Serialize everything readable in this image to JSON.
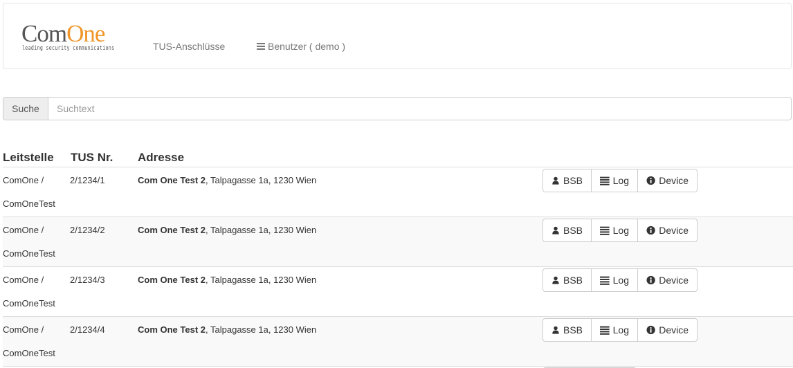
{
  "brand": {
    "logo_com": "Com",
    "logo_one": "One",
    "tagline": "leading security communications"
  },
  "nav": {
    "tus_link": "TUS-Anschlüsse",
    "user_menu": "Benutzer ( demo )",
    "user_menu_icon": "hamburger-icon"
  },
  "search": {
    "label": "Suche",
    "placeholder": "Suchtext",
    "value": ""
  },
  "table": {
    "headers": [
      "Leitstelle",
      "TUS Nr.",
      "Adresse"
    ],
    "rows": [
      {
        "leitstelle_line1": "ComOne /",
        "leitstelle_line2": "ComOneTest",
        "tus_nr": "2/1234/1",
        "address_name": "Com One Test 2",
        "address_rest": ", Talpagasse 1a, 1230 Wien"
      },
      {
        "leitstelle_line1": "ComOne /",
        "leitstelle_line2": "ComOneTest",
        "tus_nr": "2/1234/2",
        "address_name": "Com One Test 2",
        "address_rest": ", Talpagasse 1a, 1230 Wien"
      },
      {
        "leitstelle_line1": "ComOne /",
        "leitstelle_line2": "ComOneTest",
        "tus_nr": "2/1234/3",
        "address_name": "Com One Test 2",
        "address_rest": ", Talpagasse 1a, 1230 Wien"
      },
      {
        "leitstelle_line1": "ComOne /",
        "leitstelle_line2": "ComOneTest",
        "tus_nr": "2/1234/4",
        "address_name": "Com One Test 2",
        "address_rest": ", Talpagasse 1a, 1230 Wien"
      }
    ],
    "actions": {
      "bsb_label": "BSB",
      "bsb_icon": "user-icon",
      "log_label": "Log",
      "log_icon": "list-icon",
      "device_label": "Device",
      "device_icon": "info-circle-icon"
    }
  },
  "colors": {
    "brand_orange": "#f0962a",
    "brand_gray": "#555555",
    "stripe": "#f9f9f9"
  }
}
